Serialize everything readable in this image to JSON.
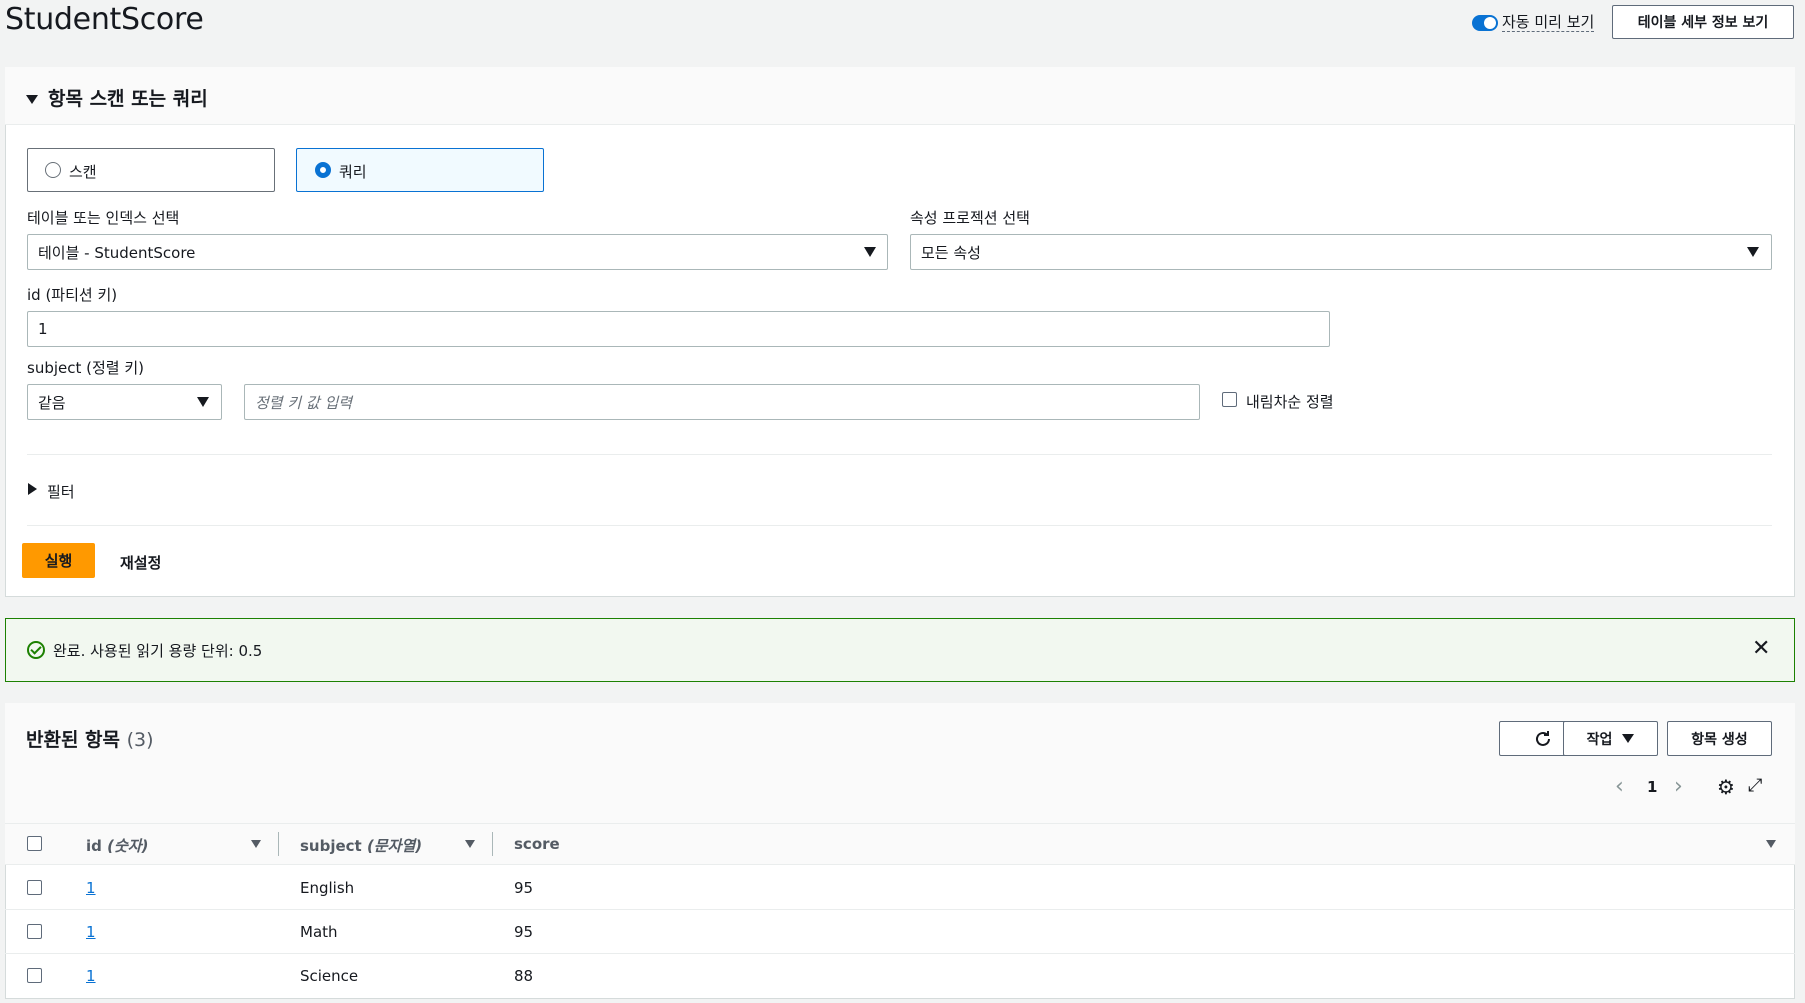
{
  "header": {
    "title": "StudentScore",
    "auto_preview_label": "자동 미리 보기",
    "details_button": "테이블 세부 정보 보기"
  },
  "query_panel": {
    "title": "항목 스캔 또는 쿼리",
    "mode_options": [
      {
        "label": "스캔",
        "selected": false
      },
      {
        "label": "쿼리",
        "selected": true
      }
    ],
    "table_index_label": "테이블 또는 인덱스 선택",
    "table_index_value": "테이블 - StudentScore",
    "projection_label": "속성 프로젝션 선택",
    "projection_value": "모든 속성",
    "partition_key_label": "id (파티션 키)",
    "partition_key_value": "1",
    "sort_key_label": "subject (정렬 키)",
    "sort_operator": "같음",
    "sort_key_placeholder": "정렬 키 값 입력",
    "descending_label": "내림차순 정렬",
    "filter_label": "필터",
    "run_button": "실행",
    "reset_button": "재설정"
  },
  "alert": {
    "text": "완료. 사용된 읽기 용량 단위: 0.5"
  },
  "results": {
    "title": "반환된 항목",
    "count": "(3)",
    "actions_button": "작업",
    "create_button": "항목 생성",
    "page": "1",
    "columns": [
      {
        "name": "id",
        "type": "(숫자)"
      },
      {
        "name": "subject",
        "type": "(문자열)"
      },
      {
        "name": "score",
        "type": ""
      }
    ],
    "rows": [
      {
        "id": "1",
        "subject": "English",
        "score": "95"
      },
      {
        "id": "1",
        "subject": "Math",
        "score": "95"
      },
      {
        "id": "1",
        "subject": "Science",
        "score": "88"
      }
    ]
  },
  "colors": {
    "accent": "#0972d3",
    "run_button": "#ff9900",
    "success": "#1d8102"
  }
}
